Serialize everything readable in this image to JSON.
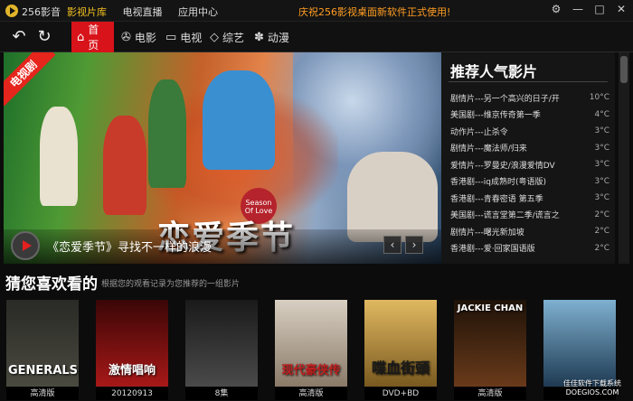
{
  "app": {
    "name": "256影音"
  },
  "topnav": {
    "items": [
      "影视片库",
      "电视直播",
      "应用中心"
    ],
    "active": 0
  },
  "promo": "庆祝256影视桌面新软件正式使用!",
  "window_controls": {
    "settings": "⚙",
    "dropdown": "▾",
    "minimize": "—",
    "maximize": "□",
    "close": "✕"
  },
  "toolbar": {
    "back_glyph": "↶",
    "refresh_glyph": "↻",
    "nav": [
      {
        "label": "首页",
        "icon": "home-icon",
        "glyph": "⌂"
      },
      {
        "label": "电影",
        "icon": "film-reel-icon",
        "glyph": "✇"
      },
      {
        "label": "电视",
        "icon": "tv-icon",
        "glyph": "▭"
      },
      {
        "label": "综艺",
        "icon": "diamond-icon",
        "glyph": "◇"
      },
      {
        "label": "动漫",
        "icon": "paw-icon",
        "glyph": "✽"
      }
    ]
  },
  "hero": {
    "ribbon": "电视剧",
    "title": "恋爱季节",
    "logo_text": "Season Of Love",
    "caption": "《恋爱季节》寻找不一样的浪漫",
    "prev": "‹",
    "next": "›"
  },
  "side_panel": {
    "title": "推荐人气影片",
    "items": [
      {
        "title": "剧情片---另一个高兴的日子/开",
        "deg": "10°C"
      },
      {
        "title": "美国剧---维京传奇第一季",
        "deg": "4°C"
      },
      {
        "title": "动作片---止杀令",
        "deg": "3°C"
      },
      {
        "title": "剧情片---魔法师/归来",
        "deg": "3°C"
      },
      {
        "title": "爱情片---罗曼史/浪漫爱情DV",
        "deg": "3°C"
      },
      {
        "title": "香港剧---iq成熟时(粤语版)",
        "deg": "3°C"
      },
      {
        "title": "香港剧---青春密语 第五季",
        "deg": "3°C"
      },
      {
        "title": "美国剧---谎言堂第二季/谎言之",
        "deg": "2°C"
      },
      {
        "title": "剧情片---曙光新加坡",
        "deg": "2°C"
      },
      {
        "title": "香港剧---爱·回家国语版",
        "deg": "2°C"
      }
    ]
  },
  "recommend": {
    "title": "猜您喜欢看的",
    "subtitle": "根据您的观看记录为您推荐的一组影片",
    "posters": [
      {
        "text": "GENERALS",
        "caption": "高清版",
        "color": "#3a3a34"
      },
      {
        "text": "激情唱响",
        "caption": "20120913",
        "color": "#7a0c0c"
      },
      {
        "text": "",
        "caption": "8集",
        "color": "#2a2a2a"
      },
      {
        "text": "现代豪侠传",
        "caption": "高清版",
        "color": "#b8a99a"
      },
      {
        "text": "喋血街頭",
        "caption": "DVD+BD",
        "color": "#c5a04a"
      },
      {
        "text": "JACKIE CHAN",
        "caption": "高清版",
        "color": "#3d2a1a"
      },
      {
        "text": "",
        "caption": "",
        "color": "#2f5a74"
      }
    ]
  },
  "watermark": "佳佳软件下载系统 DOEGIOS.COM"
}
